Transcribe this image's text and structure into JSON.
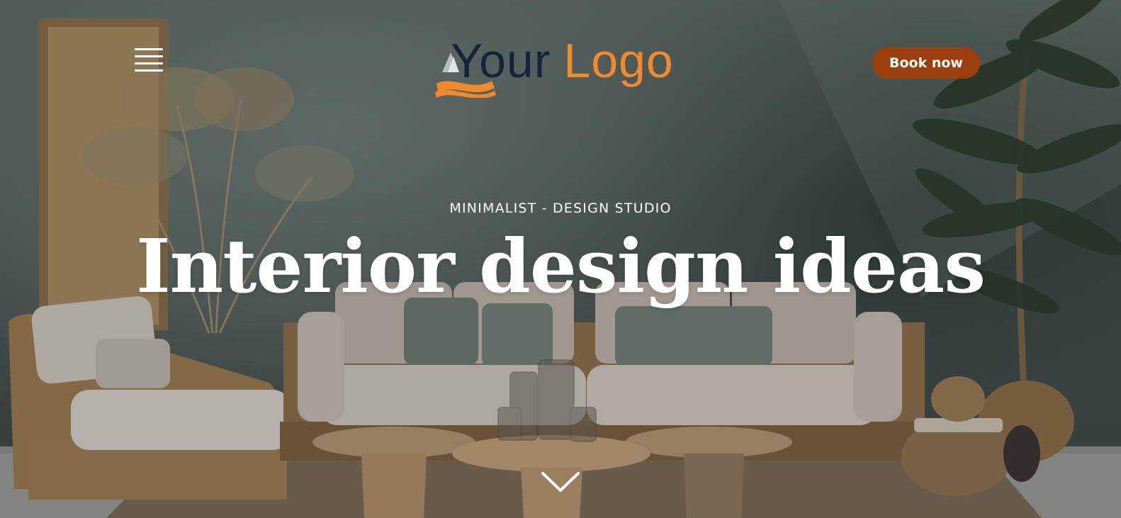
{
  "nav": {
    "menu_icon": "hamburger-menu-icon",
    "logo": {
      "text_dark": "Your",
      "text_accent": "Logo",
      "dark_color": "#15243a",
      "accent_color": "#f08a2c"
    },
    "cta_label": "Book now",
    "cta_color": "#9c3f0d"
  },
  "hero": {
    "eyebrow": "MINIMALIST - DESIGN STUDIO",
    "headline": "Interior design ideas",
    "scroll_icon": "chevron-down-icon"
  }
}
